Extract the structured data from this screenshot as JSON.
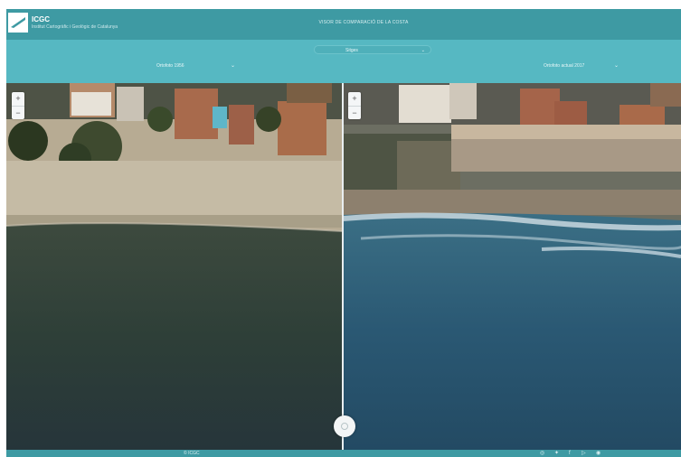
{
  "header": {
    "logo_text": "ICGC",
    "logo_subtitle": "Institut Cartogràfic i Geològic de Catalunya",
    "title": "VISOR DE COMPARACIÓ DE LA COSTA"
  },
  "toolbar": {
    "dropdown_value": "Sitges",
    "left_layer": "Ortofoto 1956",
    "right_layer": "Ortofoto actual 2017"
  },
  "map": {
    "zoom_in": "+",
    "zoom_out": "−"
  },
  "footer": {
    "link_label": "© ICGC"
  },
  "colors": {
    "header": "#3e9aa3",
    "toolbar": "#56b8c2",
    "sea_left": "#2c3c36",
    "sea_right": "#2b5b78"
  },
  "icons": [
    "map-swipe-handle",
    "zoom-in-icon",
    "zoom-out-icon",
    "instagram-icon",
    "twitter-icon",
    "facebook-icon",
    "youtube-icon",
    "linkedin-icon"
  ]
}
